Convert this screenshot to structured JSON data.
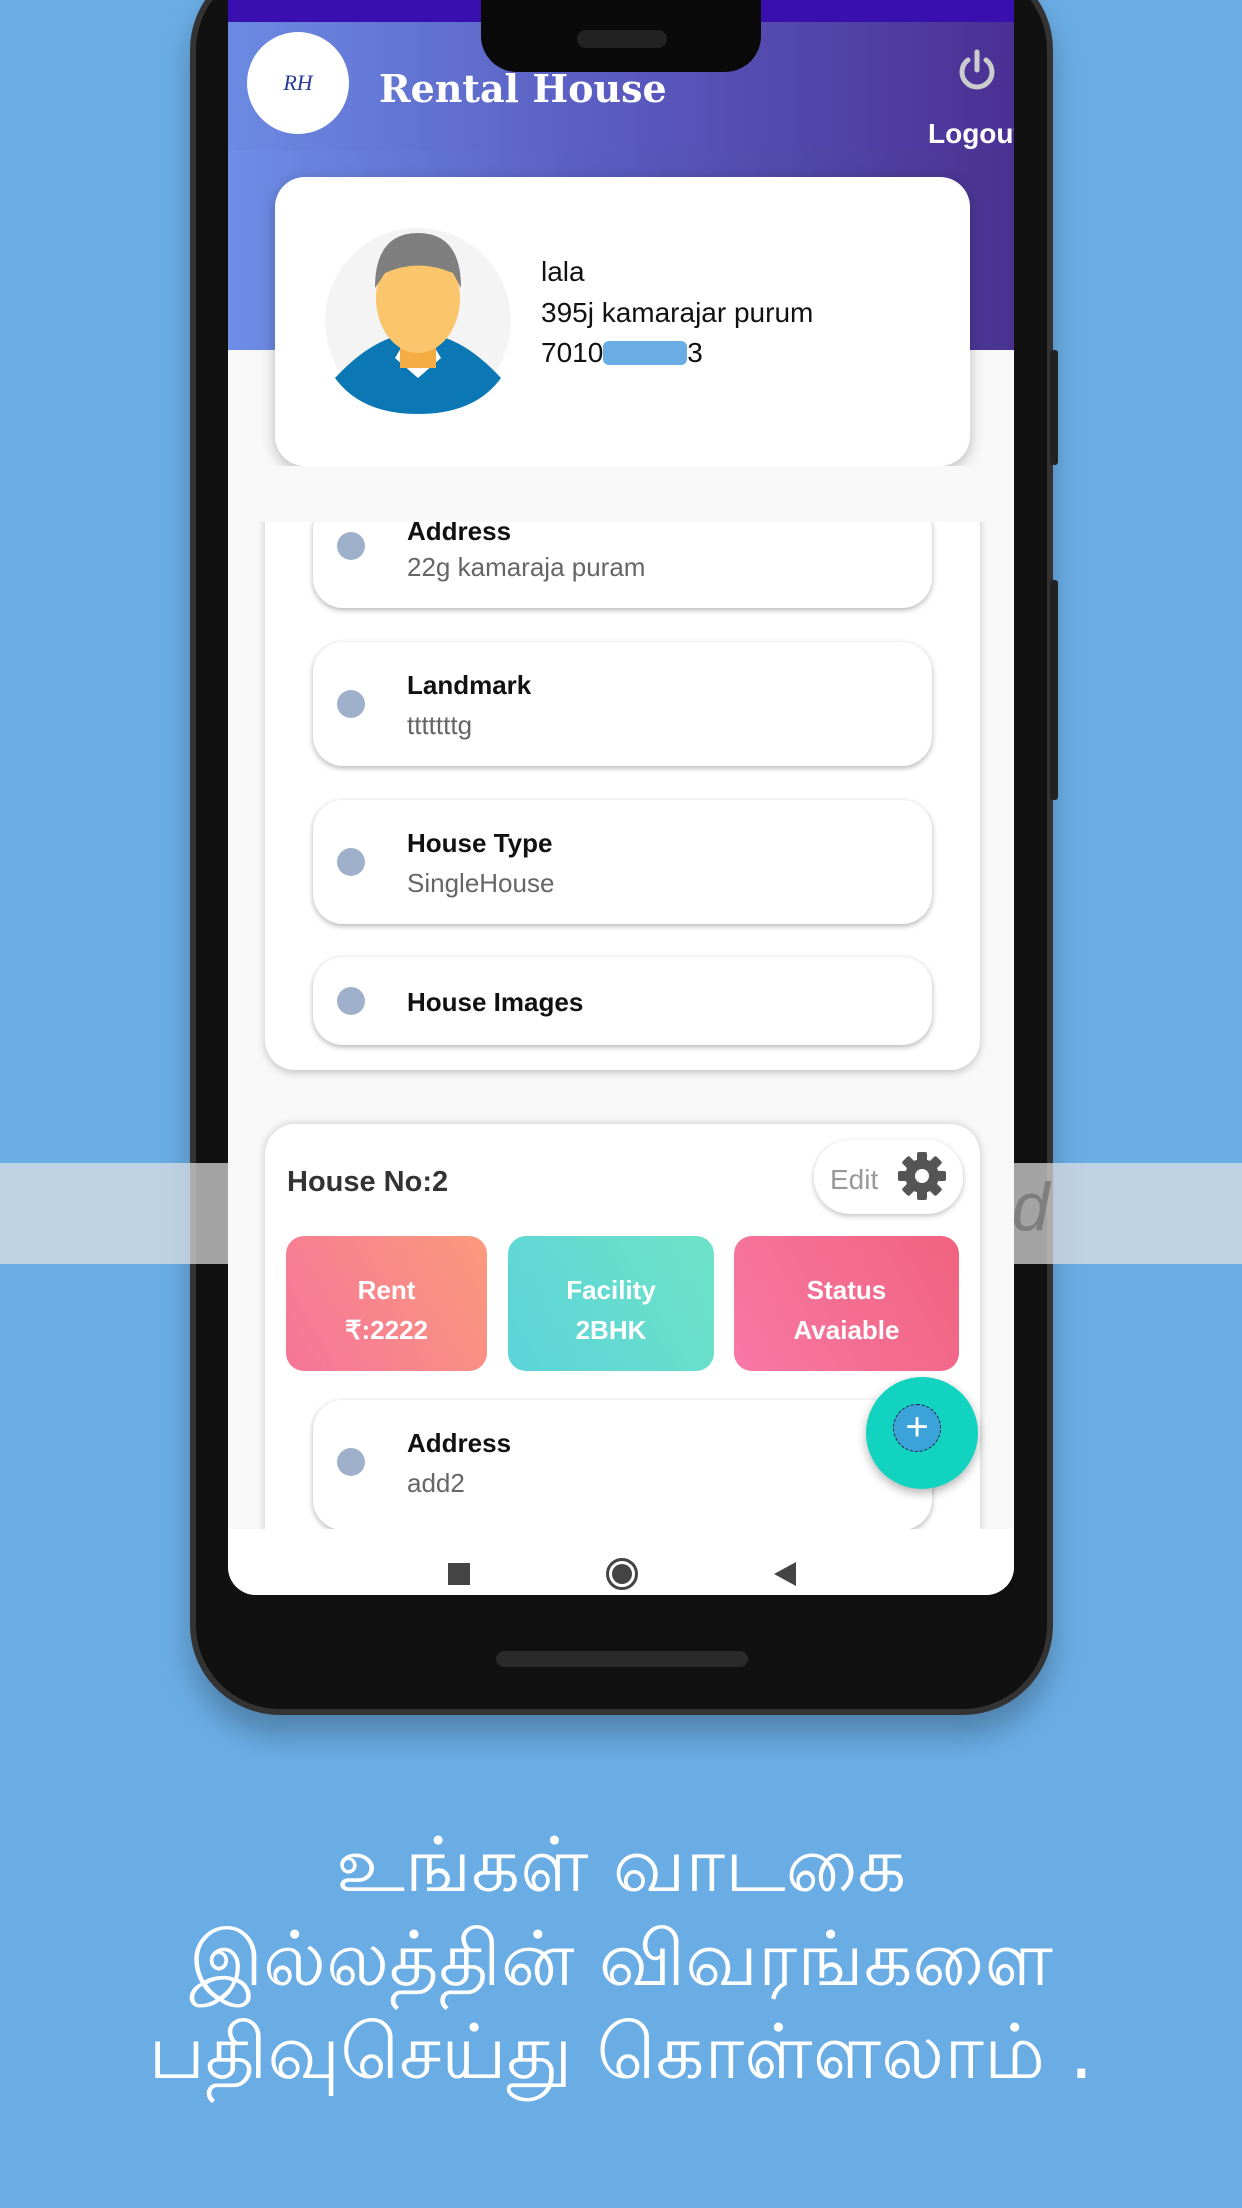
{
  "app": {
    "title": "Rental House",
    "logo_text": "RH",
    "logout_label": "Logout"
  },
  "profile": {
    "name": "lala",
    "address": "395j kamarajar purum",
    "phone_prefix": "7010",
    "phone_suffix": "3"
  },
  "house1": {
    "items": [
      {
        "label": "Address",
        "value": "22g kamaraja puram"
      },
      {
        "label": "Landmark",
        "value": "tttttttg"
      },
      {
        "label": "House Type",
        "value": "SingleHouse"
      },
      {
        "label": "House Images",
        "value": ""
      }
    ]
  },
  "house2": {
    "title": "House No:2",
    "edit_label": "Edit",
    "tiles": [
      {
        "label": "Rent",
        "value": "₹:2222",
        "colors": [
          "#f6749a",
          "#fb9a7c"
        ]
      },
      {
        "label": "Facility",
        "value": "2BHK",
        "colors": [
          "#5bd3d9",
          "#6ee3c8"
        ]
      },
      {
        "label": "Status",
        "value": "Avaiable",
        "colors": [
          "#f878a6",
          "#f0637e"
        ]
      }
    ],
    "items": [
      {
        "label": "Address",
        "value": "add2"
      }
    ]
  },
  "watermark": "AppLaunchpad",
  "caption": [
    "உங்கள் வாடகை",
    "இல்லத்தின் விவரங்களை",
    "பதிவுசெய்து கொள்ளலாம் ."
  ],
  "colors": {
    "background": "#6aade5",
    "fab": "#12d3bf",
    "header_start": "#6e8ee6",
    "header_end": "#4a3190"
  }
}
